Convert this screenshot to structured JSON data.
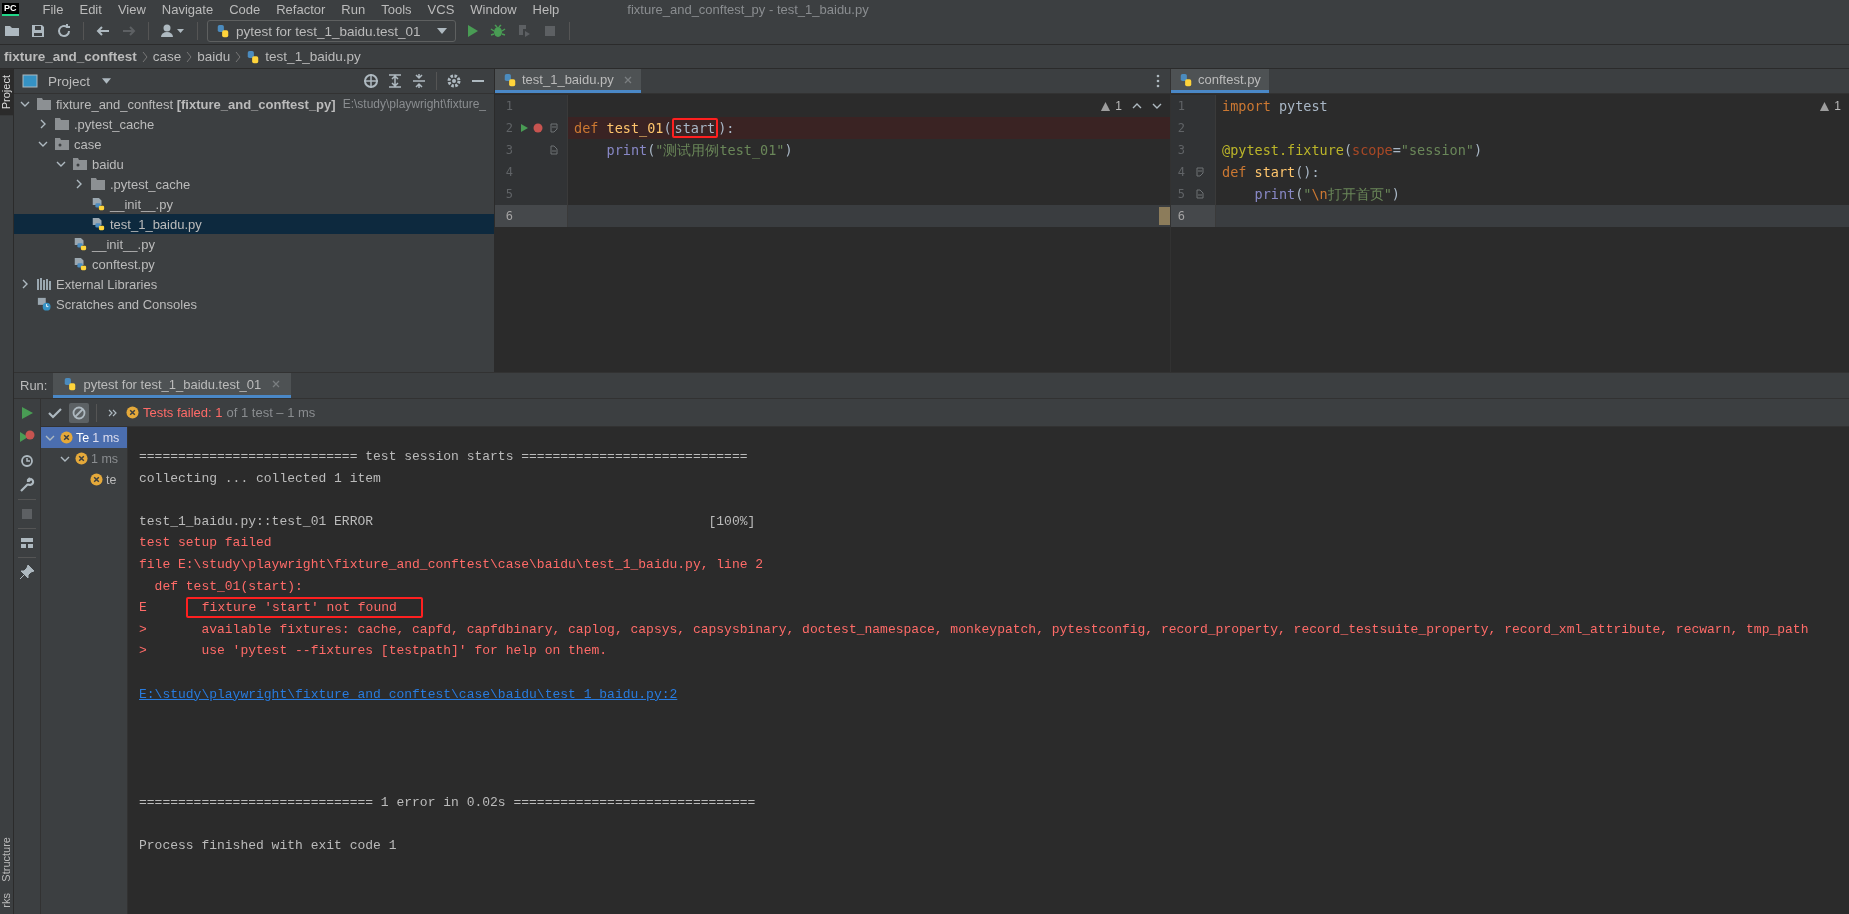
{
  "logo": "PC",
  "menu": [
    "File",
    "Edit",
    "View",
    "Navigate",
    "Code",
    "Refactor",
    "Run",
    "Tools",
    "VCS",
    "Window",
    "Help"
  ],
  "window_title": "fixture_and_conftest_py - test_1_baidu.py",
  "toolbar": {
    "run_config": "pytest for test_1_baidu.test_01"
  },
  "breadcrumb": [
    {
      "label": "fixture_and_conftest",
      "kind": "project"
    },
    {
      "label": "case",
      "kind": "folder"
    },
    {
      "label": "baidu",
      "kind": "folder"
    },
    {
      "label": "test_1_baidu.py",
      "kind": "file"
    }
  ],
  "side_tabs_top": [
    {
      "label": "Project",
      "selected": true
    }
  ],
  "side_tabs_bottom": [
    {
      "label": "Structure",
      "selected": false
    },
    {
      "label": "rks",
      "selected": false
    }
  ],
  "project": {
    "title": "Project",
    "tree": [
      {
        "label": "fixture_and_conftest **[fixture_and_conftest_py]**",
        "path": "E:\\study\\playwright\\fixture_",
        "kind": "folder",
        "expanded": true,
        "selected": false,
        "children": [
          {
            "label": ".pytest_cache",
            "kind": "folder",
            "expanded": false,
            "selected": false
          },
          {
            "label": "case",
            "kind": "package",
            "expanded": true,
            "selected": false,
            "children": [
              {
                "label": "baidu",
                "kind": "package",
                "expanded": true,
                "selected": false,
                "children": [
                  {
                    "label": ".pytest_cache",
                    "kind": "folder",
                    "expanded": false,
                    "selected": false
                  },
                  {
                    "label": "__init__.py",
                    "kind": "file",
                    "selected": false
                  },
                  {
                    "label": "test_1_baidu.py",
                    "kind": "file",
                    "selected": true
                  }
                ]
              },
              {
                "label": "__init__.py",
                "kind": "file",
                "selected": false
              },
              {
                "label": "conftest.py",
                "kind": "file",
                "selected": false
              }
            ]
          }
        ]
      },
      {
        "label": "External Libraries",
        "kind": "libraries",
        "expanded": false,
        "selected": false
      },
      {
        "label": "Scratches and Consoles",
        "kind": "scratches",
        "selected": false
      }
    ]
  },
  "editors": [
    {
      "tab": "test_1_baidu.py",
      "selected": true,
      "closable": true,
      "warnings": "1",
      "navigation": true,
      "lines": [
        {
          "number": "1",
          "breakpoint": false,
          "current": false
        },
        {
          "number": "2",
          "run_marker": true,
          "breakpoint": true,
          "current": false,
          "fold_start": true,
          "tokens": [
            {
              "kind": "keyword",
              "text": "def "
            },
            {
              "kind": "function",
              "text": "test_01"
            },
            {
              "kind": "plain",
              "text": "("
            },
            {
              "kind": "plain",
              "text": "start",
              "boxed": true
            },
            {
              "kind": "plain",
              "text": "):"
            }
          ]
        },
        {
          "number": "3",
          "breakpoint": false,
          "current": false,
          "fold_end": true,
          "indented": true,
          "tokens": [
            {
              "kind": "builtin",
              "text": "print"
            },
            {
              "kind": "plain",
              "text": "("
            },
            {
              "kind": "string",
              "text": "\"测试用例test_01\""
            },
            {
              "kind": "plain",
              "text": ")"
            }
          ]
        },
        {
          "number": "4",
          "breakpoint": false,
          "current": false
        },
        {
          "number": "5",
          "breakpoint": false,
          "current": false
        },
        {
          "number": "6",
          "breakpoint": false,
          "current": true
        }
      ]
    },
    {
      "tab": "conftest.py",
      "selected": true,
      "closable": false,
      "warnings": "1",
      "navigation": false,
      "lines": [
        {
          "number": "1",
          "breakpoint": false,
          "current": false,
          "tokens": [
            {
              "kind": "keyword",
              "text": "import "
            },
            {
              "kind": "plain",
              "text": "pytest"
            }
          ]
        },
        {
          "number": "2",
          "breakpoint": false,
          "current": false
        },
        {
          "number": "3",
          "breakpoint": false,
          "current": false,
          "tokens": [
            {
              "kind": "decorator",
              "text": "@pytest.fixture"
            },
            {
              "kind": "plain",
              "text": "("
            },
            {
              "kind": "kwarg",
              "text": "scope"
            },
            {
              "kind": "plain",
              "text": "="
            },
            {
              "kind": "string",
              "text": "\"session\""
            },
            {
              "kind": "plain",
              "text": ")"
            }
          ]
        },
        {
          "number": "4",
          "breakpoint": false,
          "current": false,
          "fold_start": true,
          "tokens": [
            {
              "kind": "keyword",
              "text": "def "
            },
            {
              "kind": "function",
              "text": "start"
            },
            {
              "kind": "plain",
              "text": "():"
            }
          ]
        },
        {
          "number": "5",
          "breakpoint": false,
          "current": false,
          "fold_end": true,
          "indented": true,
          "tokens": [
            {
              "kind": "builtin",
              "text": "print"
            },
            {
              "kind": "plain",
              "text": "("
            },
            {
              "kind": "string",
              "text": "\""
            },
            {
              "kind": "escape",
              "text": "\\n"
            },
            {
              "kind": "string",
              "text": "打开首页\""
            },
            {
              "kind": "plain",
              "text": ")"
            }
          ]
        },
        {
          "number": "6",
          "breakpoint": false,
          "current": true
        }
      ]
    }
  ],
  "run": {
    "label": "Run:",
    "tab": "pytest for test_1_baidu.test_01",
    "status_failed": "Tests failed: 1",
    "status_rest": "of 1 test – 1 ms",
    "tree": [
      {
        "label": "Te",
        "time": "1 ms",
        "selected": true,
        "expanded": true,
        "children": [
          {
            "time": "1 ms",
            "selected": false,
            "expanded": true,
            "children": [
              {
                "label": "te",
                "selected": false
              }
            ]
          }
        ]
      }
    ],
    "console": [
      {
        "kind": "normal",
        "text": "============================ test session starts ============================="
      },
      {
        "kind": "normal",
        "text": "collecting ... collected 1 item"
      },
      {
        "kind": "blank"
      },
      {
        "kind": "normal",
        "text": "test_1_baidu.py::test_01 ERROR                                           [100%]"
      },
      {
        "kind": "error",
        "text": "test setup failed"
      },
      {
        "kind": "error",
        "text": "file E:\\study\\playwright\\fixture_and_conftest\\case\\baidu\\test_1_baidu.py, line 2"
      },
      {
        "kind": "error",
        "text": "  def test_01(start):"
      },
      {
        "kind": "error",
        "text": "E",
        "boxed_text": "fixture 'start' not found"
      },
      {
        "kind": "error",
        "text": ">       available fixtures: cache, capfd, capfdbinary, caplog, capsys, capsysbinary, doctest_namespace, monkeypatch, pytestconfig, record_property, record_testsuite_property, record_xml_attribute, recwarn, tmp_path"
      },
      {
        "kind": "error",
        "text": ">       use 'pytest --fixtures [testpath]' for help on them."
      },
      {
        "kind": "blank"
      },
      {
        "kind": "link",
        "text": "E:\\study\\playwright\\fixture_and_conftest\\case\\baidu\\test_1_baidu.py:2"
      },
      {
        "kind": "blank"
      },
      {
        "kind": "blank"
      },
      {
        "kind": "blank"
      },
      {
        "kind": "blank"
      },
      {
        "kind": "normal",
        "text": "============================== 1 error in 0.02s ==============================="
      },
      {
        "kind": "blank"
      },
      {
        "kind": "normal",
        "text": "Process finished with exit code 1"
      }
    ]
  }
}
